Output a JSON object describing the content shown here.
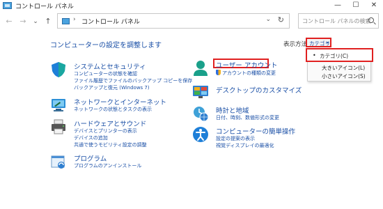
{
  "window": {
    "title": "コントロール パネル"
  },
  "nav": {
    "back": "←",
    "forward": "→",
    "dropdown": "⌄",
    "up": "↑"
  },
  "address": {
    "separator": "›",
    "path": "コントロール パネル",
    "chevron": "⌄",
    "refresh": "↻"
  },
  "search": {
    "placeholder": "コントロール パネルの検索"
  },
  "heading": "コンピューターの設定を調整します",
  "viewby": {
    "label": "表示方法:",
    "value": "カテゴリ",
    "arrow": "▾"
  },
  "view_menu": {
    "items": [
      {
        "label": "カテゴリ(C)",
        "selected": true
      },
      {
        "label": "大きいアイコン(L)",
        "selected": false
      },
      {
        "label": "小さいアイコン(S)",
        "selected": false
      }
    ]
  },
  "categories_left": [
    {
      "title": "システムとセキュリティ",
      "icon": "shield-icon",
      "links": [
        "コンピューターの状態を確認",
        "ファイル履歴でファイルのバックアップ コピーを保存",
        "バックアップと復元 (Windows 7)"
      ]
    },
    {
      "title": "ネットワークとインターネット",
      "icon": "network-icon",
      "links": [
        "ネットワークの状態とタスクの表示"
      ]
    },
    {
      "title": "ハードウェアとサウンド",
      "icon": "printer-icon",
      "links": [
        "デバイスとプリンターの表示",
        "デバイスの追加",
        "共通で使うモビリティ設定の調整"
      ]
    },
    {
      "title": "プログラム",
      "icon": "programs-icon",
      "links": [
        "プログラムのアンインストール"
      ]
    }
  ],
  "categories_right": [
    {
      "title": "ユーザー アカウント",
      "icon": "user-icon",
      "links": [
        "アカウントの種類の変更"
      ]
    },
    {
      "title": "デスクトップのカスタマイズ",
      "icon": "desktop-icon",
      "links": []
    },
    {
      "title": "時計と地域",
      "icon": "clock-icon",
      "links": [
        "日付、時刻、数値形式の変更"
      ]
    },
    {
      "title": "コンピューターの簡単操作",
      "icon": "accessibility-icon",
      "links": [
        "設定の提案の表示",
        "視覚ディスプレイの最適化"
      ]
    }
  ],
  "window_controls": {
    "minimize": "—",
    "maximize": "☐",
    "close": "✕"
  },
  "colors": {
    "accent": "#1a4fa6",
    "highlight": "#e02020"
  }
}
